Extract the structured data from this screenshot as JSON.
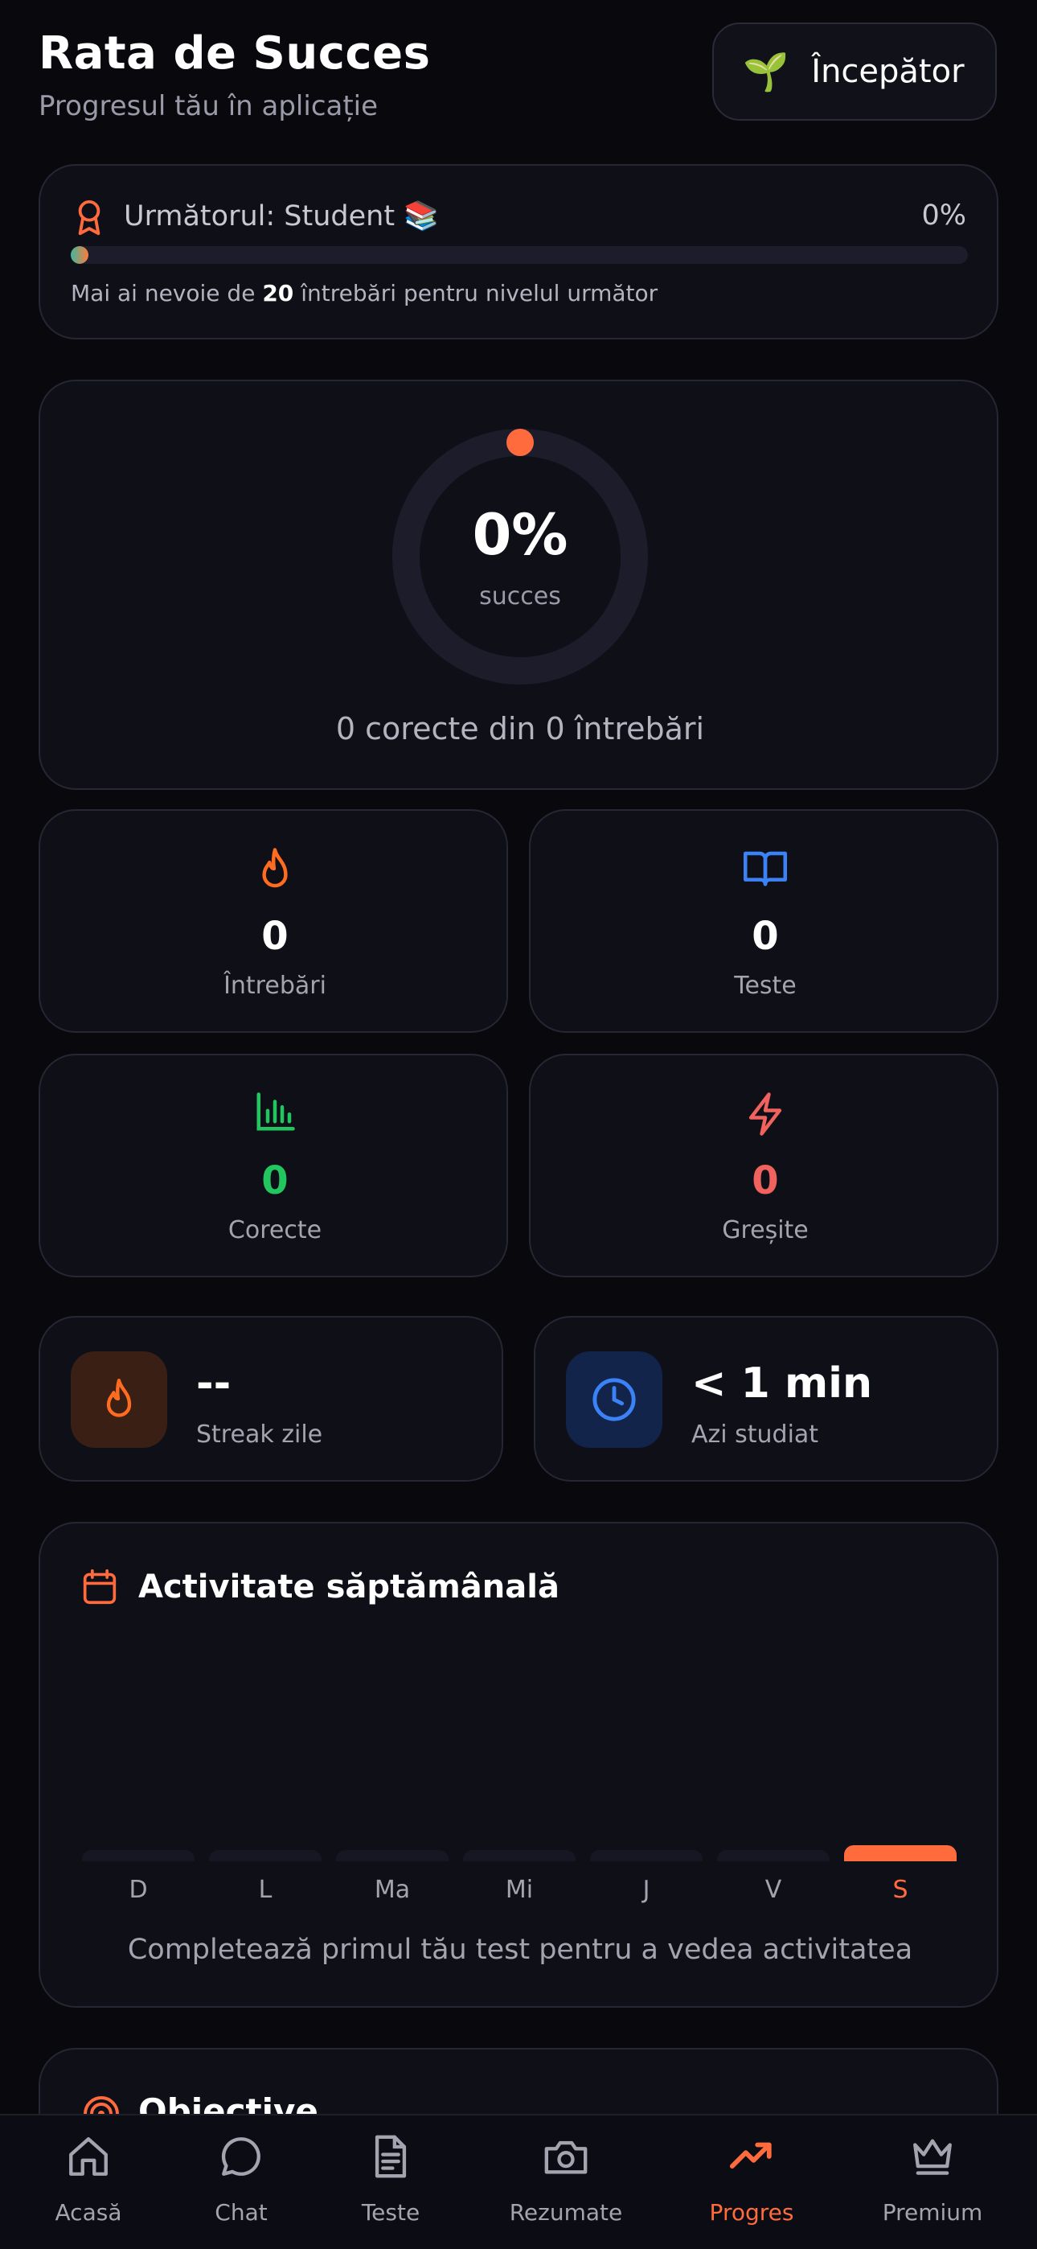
{
  "header": {
    "title": "Rata de Succes",
    "subtitle": "Progresul tău în aplicație",
    "level_icon": "sprout-emoji",
    "level_label": "Începător"
  },
  "next_level": {
    "label": "Următorul: Student 📚",
    "percent_label": "0%",
    "progress": 0,
    "hint_prefix": "Mai ai nevoie de ",
    "hint_count": "20",
    "hint_suffix": " întrebări pentru nivelul următor"
  },
  "success": {
    "percent_label": "0%",
    "sub_label": "succes",
    "caption": "0 corecte din 0 întrebări",
    "rate": 0
  },
  "stats": [
    {
      "icon": "flame-icon",
      "value": "0",
      "label": "Întrebări",
      "color": "#ff6b1f"
    },
    {
      "icon": "book-open-icon",
      "value": "0",
      "label": "Teste",
      "color": "#3b82f6"
    },
    {
      "icon": "bar-chart-icon",
      "value": "0",
      "label": "Corecte",
      "color": "#22c55e"
    },
    {
      "icon": "lightning-icon",
      "value": "0",
      "label": "Greșite",
      "color": "#f0625e"
    }
  ],
  "streak": {
    "value": "--",
    "label": "Streak zile",
    "icon": "flame-icon"
  },
  "time": {
    "value": "< 1 min",
    "label": "Azi studiat",
    "icon": "clock-icon"
  },
  "weekly": {
    "title": "Activitate săptămânală",
    "days": [
      "D",
      "L",
      "Ma",
      "Mi",
      "J",
      "V",
      "S"
    ],
    "active_day": "S",
    "caption": "Completează primul tău test pentru a vedea activitatea"
  },
  "objectives": {
    "title": "Obiective"
  },
  "nav": {
    "items": [
      {
        "label": "Acasă",
        "icon": "home-icon"
      },
      {
        "label": "Chat",
        "icon": "chat-icon"
      },
      {
        "label": "Teste",
        "icon": "document-icon"
      },
      {
        "label": "Rezumate",
        "icon": "camera-icon"
      },
      {
        "label": "Progres",
        "icon": "trending-up-icon"
      },
      {
        "label": "Premium",
        "icon": "crown-icon"
      }
    ],
    "active": "Progres"
  },
  "colors": {
    "accent": "#ff6b3d",
    "background": "#08080d",
    "card": "#0f0f18"
  }
}
